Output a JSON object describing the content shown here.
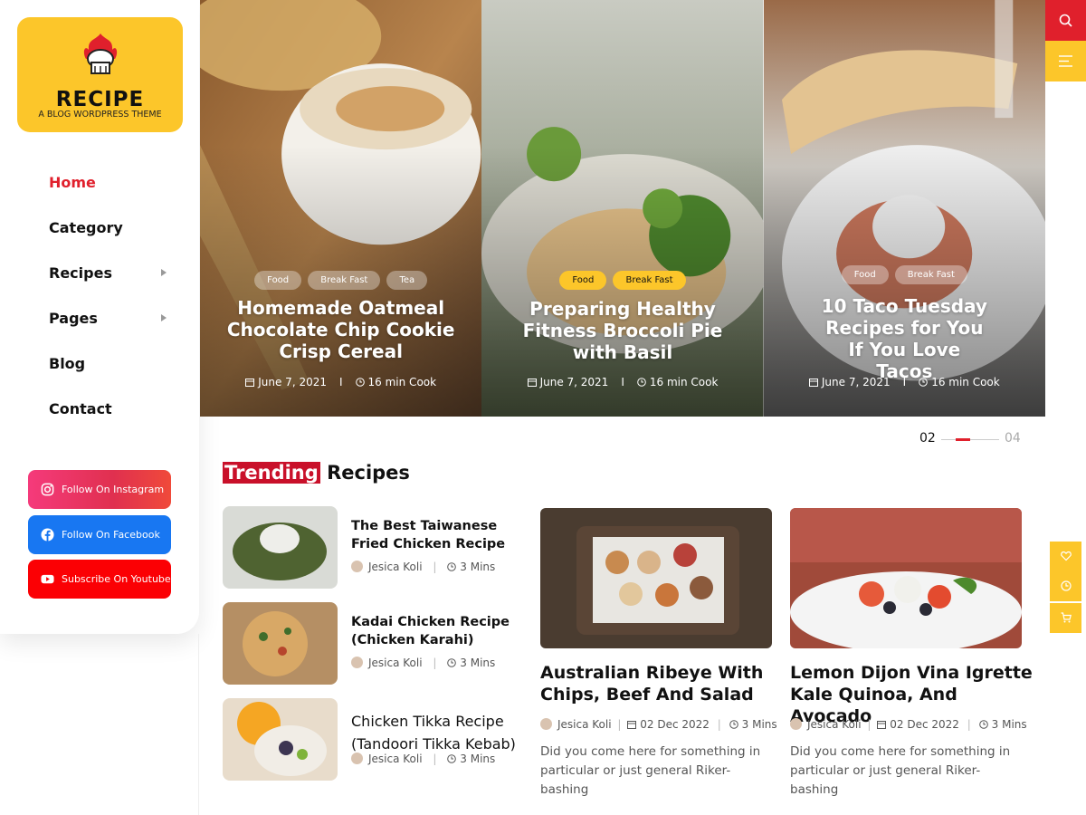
{
  "brand": {
    "title": "RECIPE",
    "subtitle": "A BLOG WORDPRESS THEME",
    "accent": "#fcc62a",
    "red": "#e0202c"
  },
  "nav": {
    "items": [
      {
        "label": "Home",
        "active": true,
        "has_submenu": false
      },
      {
        "label": "Category",
        "active": false,
        "has_submenu": false
      },
      {
        "label": "Recipes",
        "active": false,
        "has_submenu": true
      },
      {
        "label": "Pages",
        "active": false,
        "has_submenu": true
      },
      {
        "label": "Blog",
        "active": false,
        "has_submenu": false
      },
      {
        "label": "Contact",
        "active": false,
        "has_submenu": false
      }
    ]
  },
  "social": {
    "instagram": "Follow On Instagram",
    "facebook": "Follow On Facebook",
    "youtube": "Subscribe On Youtube"
  },
  "hero": {
    "slides": [
      {
        "tags": [
          "Food",
          "Break Fast",
          "Tea"
        ],
        "title": "Homemade Oatmeal Chocolate Chip Cookie Crisp Cereal",
        "date": "June 7, 2021",
        "cook": "16 min Cook"
      },
      {
        "tags": [
          "Food",
          "Break Fast"
        ],
        "title": "Preparing Healthy Fitness Broccoli Pie with Basil",
        "date": "June 7, 2021",
        "cook": "16 min Cook"
      },
      {
        "tags": [
          "Food",
          "Break Fast"
        ],
        "title": "10 Taco Tuesday Recipes for You If You Love Tacos",
        "date": "June 7, 2021",
        "cook": "16 min Cook"
      }
    ],
    "sep": "I"
  },
  "pager": {
    "current": "02",
    "total": "04"
  },
  "trending": {
    "title_highlight": "Trending",
    "title_rest": "Recipes",
    "list": [
      {
        "title": "The Best Taiwanese Fried Chicken Recipe",
        "author": "Jesica Koli",
        "time": "3 Mins"
      },
      {
        "title": "Kadai Chicken Recipe (Chicken Karahi)",
        "author": "Jesica Koli",
        "time": "3 Mins"
      },
      {
        "title": "Chicken Tikka Recipe (Tandoori Tikka Kebab)",
        "author": "Jesica Koli",
        "time": "3 Mins"
      }
    ],
    "cards": [
      {
        "title": "Australian Ribeye With Chips, Beef And Salad",
        "author": "Jesica Koli",
        "date": "02 Dec 2022",
        "time": "3 Mins",
        "excerpt": "Did you come here for something in particular or just general Riker-bashing"
      },
      {
        "title": "Lemon Dijon Vina Igrette Kale Quinoa, And Avocado",
        "author": "Jesica Koli",
        "date": "02 Dec 2022",
        "time": "3 Mins",
        "excerpt": "Did you come here for something in particular or just general Riker-bashing"
      }
    ]
  },
  "icons": {
    "search": "search-icon",
    "menu": "menu-icon",
    "side": [
      "heart-icon",
      "clock-icon",
      "cart-icon"
    ]
  }
}
